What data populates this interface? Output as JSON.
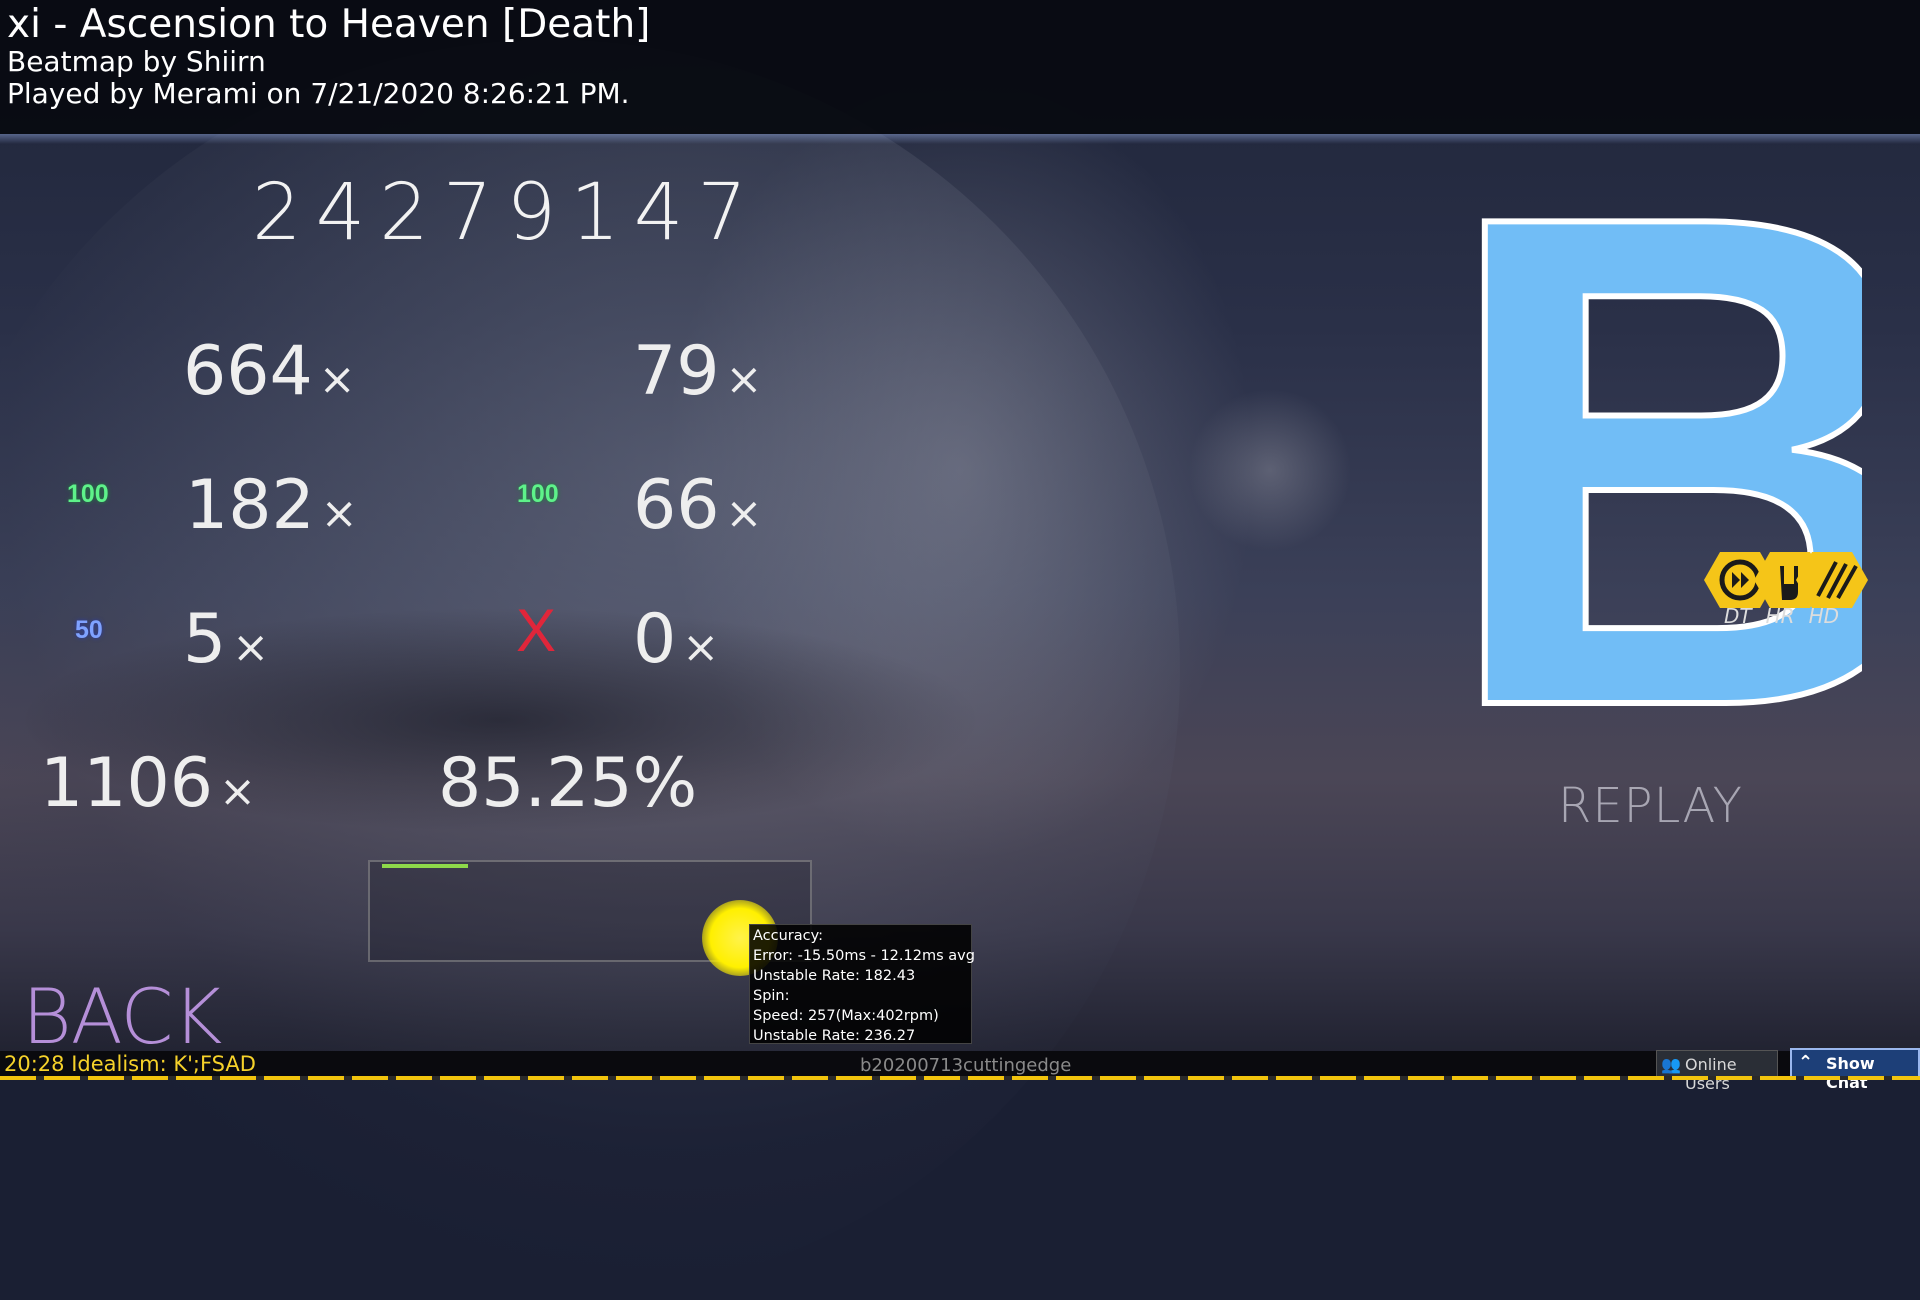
{
  "header": {
    "title": "xi - Ascension to Heaven [Death]",
    "beatmap": "Beatmap by Shiirn",
    "played": "Played by Merami on 7/21/2020 8:26:21 PM."
  },
  "score": "24279147",
  "hits": {
    "count300": "664",
    "geki": "79",
    "count100": "182",
    "katu": "66",
    "count50": "5",
    "miss": "0",
    "x": "×",
    "label100": "100",
    "label50": "50",
    "miss_label": "X"
  },
  "combo": "1106",
  "accuracy": "85.25%",
  "tooltip": {
    "line1": "Accuracy:",
    "line2": "Error: -15.50ms - 12.12ms avg",
    "line3": "Unstable Rate: 182.43",
    "line4": "Spin:",
    "line5": "Speed: 257(Max:402rpm)",
    "line6": "Unstable Rate: 236.27"
  },
  "rank": {
    "grade": "B",
    "color": "#71bdf6"
  },
  "mods": [
    "DT",
    "HR",
    "HD"
  ],
  "mods_color": "#f5c518",
  "replay_label": "REPLAY",
  "back_label": "BACK",
  "bottom": {
    "now_playing": "20:28 Idealism: K';FSAD",
    "build": "b20200713cuttingedge",
    "online_users": "Online Users",
    "show_chat": "Show Chat"
  }
}
